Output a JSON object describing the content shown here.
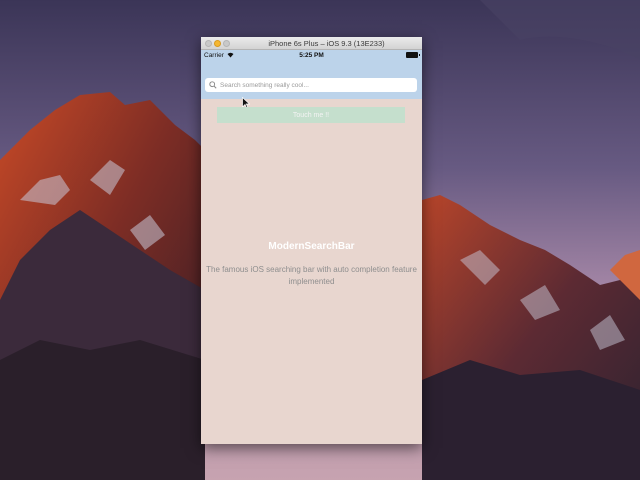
{
  "window": {
    "title": "iPhone 6s Plus – iOS 9.3 (13E233)"
  },
  "status_bar": {
    "carrier": "Carrier",
    "time": "5:25 PM"
  },
  "search": {
    "placeholder": "Search something really cool..."
  },
  "touch_button": {
    "label": "Touch me !!"
  },
  "content": {
    "title": "ModernSearchBar",
    "subtitle": "The famous iOS searching bar with auto completion feature implemented"
  },
  "colors": {
    "header_bar": "#bcd3ea",
    "screen_background": "#e8d6cf",
    "button_background": "#c5dfcd",
    "minimize_button": "#f5b731"
  },
  "icons": {
    "search": "search-icon",
    "wifi": "wifi-icon",
    "battery": "battery-icon",
    "cursor": "cursor-icon"
  }
}
